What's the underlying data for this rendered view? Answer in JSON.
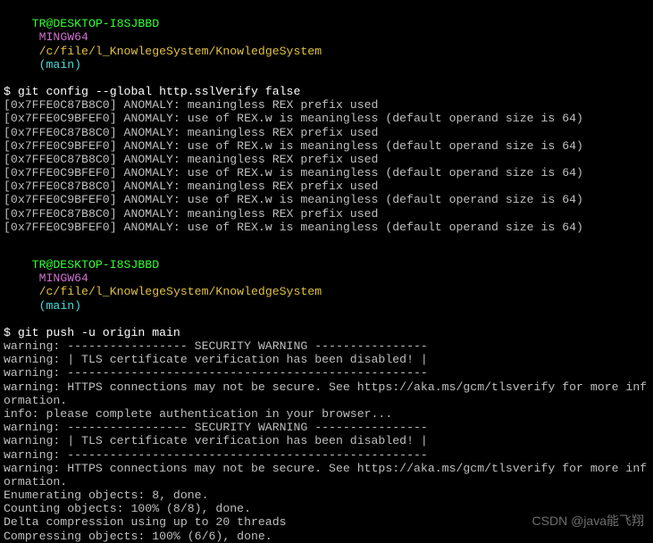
{
  "prompt1": {
    "userhost": "TR@DESKTOP-I8SJBBD",
    "env": "MINGW64",
    "path": "/c/file/l_KnowlegeSystem/KnowledgeSystem",
    "branch": "(main)",
    "cmd": "$ git config --global http.sslVerify false"
  },
  "anomaly": {
    "a": "[0x7FFE0C87B8C0] ANOMALY: meaningless REX prefix used",
    "b": "[0x7FFE0C9BFEF0] ANOMALY: use of REX.w is meaningless (default operand size is 64)"
  },
  "prompt2": {
    "userhost": "TR@DESKTOP-I8SJBBD",
    "env": "MINGW64",
    "path": "/c/file/l_KnowlegeSystem/KnowledgeSystem",
    "branch": "(main)",
    "cmd": "$ git push -u origin main"
  },
  "out": {
    "l01": "warning: ----------------- SECURITY WARNING ----------------",
    "l02": "warning: | TLS certificate verification has been disabled! |",
    "l03": "warning: ---------------------------------------------------",
    "l04": "warning: HTTPS connections may not be secure. See https://aka.ms/gcm/tlsverify for more information.",
    "l05": "info: please complete authentication in your browser...",
    "l06": "warning: ----------------- SECURITY WARNING ----------------",
    "l07": "warning: | TLS certificate verification has been disabled! |",
    "l08": "warning: ---------------------------------------------------",
    "l09": "warning: HTTPS connections may not be secure. See https://aka.ms/gcm/tlsverify for more information.",
    "l10": "Enumerating objects: 8, done.",
    "l11": "Counting objects: 100% (8/8), done.",
    "l12": "Delta compression using up to 20 threads",
    "l13": "Compressing objects: 100% (6/6), done."
  },
  "watermark": "CSDN @java能飞翔"
}
